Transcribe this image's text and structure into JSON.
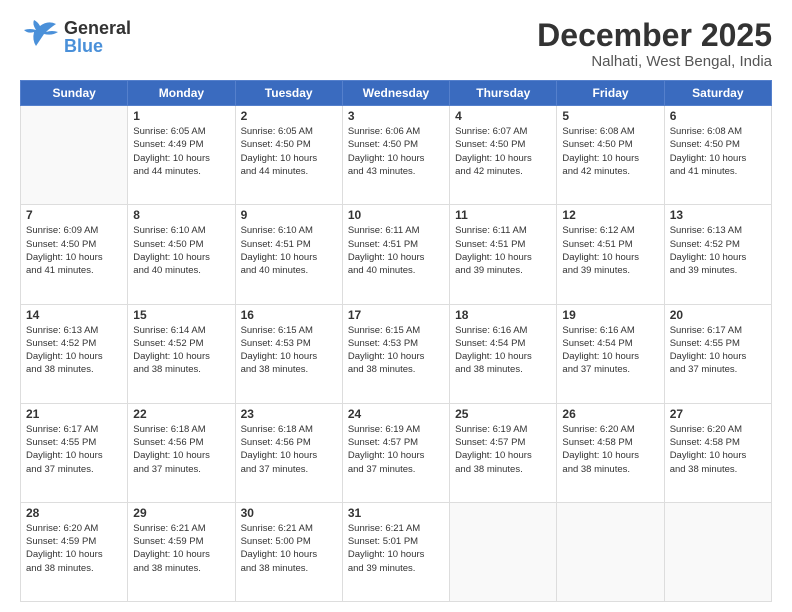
{
  "logo": {
    "text1": "General",
    "text2": "Blue"
  },
  "header": {
    "month": "December 2025",
    "location": "Nalhati, West Bengal, India"
  },
  "days_of_week": [
    "Sunday",
    "Monday",
    "Tuesday",
    "Wednesday",
    "Thursday",
    "Friday",
    "Saturday"
  ],
  "weeks": [
    [
      {
        "day": "",
        "info": ""
      },
      {
        "day": "1",
        "info": "Sunrise: 6:05 AM\nSunset: 4:49 PM\nDaylight: 10 hours\nand 44 minutes."
      },
      {
        "day": "2",
        "info": "Sunrise: 6:05 AM\nSunset: 4:50 PM\nDaylight: 10 hours\nand 44 minutes."
      },
      {
        "day": "3",
        "info": "Sunrise: 6:06 AM\nSunset: 4:50 PM\nDaylight: 10 hours\nand 43 minutes."
      },
      {
        "day": "4",
        "info": "Sunrise: 6:07 AM\nSunset: 4:50 PM\nDaylight: 10 hours\nand 42 minutes."
      },
      {
        "day": "5",
        "info": "Sunrise: 6:08 AM\nSunset: 4:50 PM\nDaylight: 10 hours\nand 42 minutes."
      },
      {
        "day": "6",
        "info": "Sunrise: 6:08 AM\nSunset: 4:50 PM\nDaylight: 10 hours\nand 41 minutes."
      }
    ],
    [
      {
        "day": "7",
        "info": "Sunrise: 6:09 AM\nSunset: 4:50 PM\nDaylight: 10 hours\nand 41 minutes."
      },
      {
        "day": "8",
        "info": "Sunrise: 6:10 AM\nSunset: 4:50 PM\nDaylight: 10 hours\nand 40 minutes."
      },
      {
        "day": "9",
        "info": "Sunrise: 6:10 AM\nSunset: 4:51 PM\nDaylight: 10 hours\nand 40 minutes."
      },
      {
        "day": "10",
        "info": "Sunrise: 6:11 AM\nSunset: 4:51 PM\nDaylight: 10 hours\nand 40 minutes."
      },
      {
        "day": "11",
        "info": "Sunrise: 6:11 AM\nSunset: 4:51 PM\nDaylight: 10 hours\nand 39 minutes."
      },
      {
        "day": "12",
        "info": "Sunrise: 6:12 AM\nSunset: 4:51 PM\nDaylight: 10 hours\nand 39 minutes."
      },
      {
        "day": "13",
        "info": "Sunrise: 6:13 AM\nSunset: 4:52 PM\nDaylight: 10 hours\nand 39 minutes."
      }
    ],
    [
      {
        "day": "14",
        "info": "Sunrise: 6:13 AM\nSunset: 4:52 PM\nDaylight: 10 hours\nand 38 minutes."
      },
      {
        "day": "15",
        "info": "Sunrise: 6:14 AM\nSunset: 4:52 PM\nDaylight: 10 hours\nand 38 minutes."
      },
      {
        "day": "16",
        "info": "Sunrise: 6:15 AM\nSunset: 4:53 PM\nDaylight: 10 hours\nand 38 minutes."
      },
      {
        "day": "17",
        "info": "Sunrise: 6:15 AM\nSunset: 4:53 PM\nDaylight: 10 hours\nand 38 minutes."
      },
      {
        "day": "18",
        "info": "Sunrise: 6:16 AM\nSunset: 4:54 PM\nDaylight: 10 hours\nand 38 minutes."
      },
      {
        "day": "19",
        "info": "Sunrise: 6:16 AM\nSunset: 4:54 PM\nDaylight: 10 hours\nand 37 minutes."
      },
      {
        "day": "20",
        "info": "Sunrise: 6:17 AM\nSunset: 4:55 PM\nDaylight: 10 hours\nand 37 minutes."
      }
    ],
    [
      {
        "day": "21",
        "info": "Sunrise: 6:17 AM\nSunset: 4:55 PM\nDaylight: 10 hours\nand 37 minutes."
      },
      {
        "day": "22",
        "info": "Sunrise: 6:18 AM\nSunset: 4:56 PM\nDaylight: 10 hours\nand 37 minutes."
      },
      {
        "day": "23",
        "info": "Sunrise: 6:18 AM\nSunset: 4:56 PM\nDaylight: 10 hours\nand 37 minutes."
      },
      {
        "day": "24",
        "info": "Sunrise: 6:19 AM\nSunset: 4:57 PM\nDaylight: 10 hours\nand 37 minutes."
      },
      {
        "day": "25",
        "info": "Sunrise: 6:19 AM\nSunset: 4:57 PM\nDaylight: 10 hours\nand 38 minutes."
      },
      {
        "day": "26",
        "info": "Sunrise: 6:20 AM\nSunset: 4:58 PM\nDaylight: 10 hours\nand 38 minutes."
      },
      {
        "day": "27",
        "info": "Sunrise: 6:20 AM\nSunset: 4:58 PM\nDaylight: 10 hours\nand 38 minutes."
      }
    ],
    [
      {
        "day": "28",
        "info": "Sunrise: 6:20 AM\nSunset: 4:59 PM\nDaylight: 10 hours\nand 38 minutes."
      },
      {
        "day": "29",
        "info": "Sunrise: 6:21 AM\nSunset: 4:59 PM\nDaylight: 10 hours\nand 38 minutes."
      },
      {
        "day": "30",
        "info": "Sunrise: 6:21 AM\nSunset: 5:00 PM\nDaylight: 10 hours\nand 38 minutes."
      },
      {
        "day": "31",
        "info": "Sunrise: 6:21 AM\nSunset: 5:01 PM\nDaylight: 10 hours\nand 39 minutes."
      },
      {
        "day": "",
        "info": ""
      },
      {
        "day": "",
        "info": ""
      },
      {
        "day": "",
        "info": ""
      }
    ]
  ]
}
